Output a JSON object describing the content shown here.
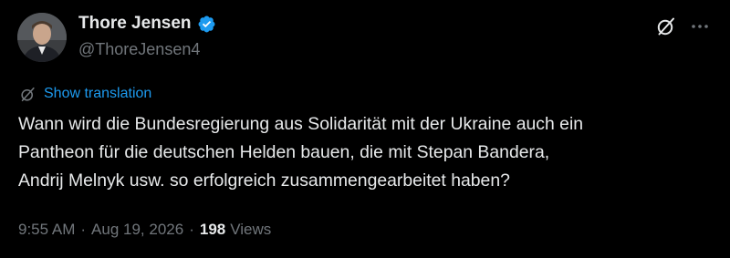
{
  "author": {
    "display_name": "Thore Jensen",
    "handle": "@ThoreJensen4",
    "verified": true
  },
  "translation": {
    "label": "Show translation"
  },
  "tweet": {
    "lines": [
      "Wann wird die Bundesregierung aus Solidarität mit der Ukraine auch ein",
      "Pantheon für die deutschen Helden bauen, die mit Stepan Bandera,",
      "Andrij Melnyk usw. so erfolgreich zusammengearbeitet haben?"
    ]
  },
  "meta": {
    "time": "9:55 AM",
    "separator": "·",
    "date": "Aug 19, 2026",
    "views_count": "198",
    "views_label": "Views"
  },
  "colors": {
    "background": "#000000",
    "text_primary": "#e7e9ea",
    "text_secondary": "#71767b",
    "accent": "#1d9bf0"
  },
  "icons": {
    "verified": "verified-badge-icon",
    "grok": "grok-icon",
    "more": "more-options-icon",
    "translate": "translate-icon"
  }
}
